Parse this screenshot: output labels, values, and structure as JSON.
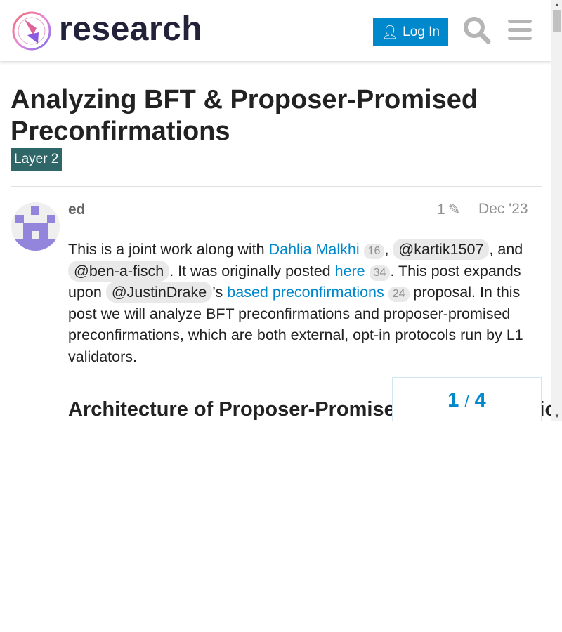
{
  "header": {
    "brand": "research",
    "login_label": "Log In"
  },
  "topic": {
    "title": "Analyzing BFT & Proposer-Promised Preconfirmations",
    "tag": "Layer 2"
  },
  "post": {
    "username": "ed",
    "edits": "1",
    "date": "Dec '23",
    "t1": "This is a joint work along with ",
    "link1": "Dahlia Malkhi",
    "c1": "16",
    "t2": ", ",
    "m1": "@kartik1507",
    "t3": ", and ",
    "m2": "@ben-a-fisch",
    "t4": ". It was originally posted ",
    "link2": "here",
    "c2": "34",
    "t5": ". This post expands upon ",
    "m3": "@JustinDrake",
    "t6": "’s ",
    "link3": "based preconfirmations",
    "c3": "24",
    "t7": " proposal. In this post we will analyze BFT preconfirmations and proposer-promised preconfirmations, which are both external, opt-in protocols run by L1 validators.",
    "heading": "Architecture of Proposer-Promised Preconfirmations"
  },
  "progress": {
    "current": "1",
    "sep": "/",
    "total": "4"
  }
}
